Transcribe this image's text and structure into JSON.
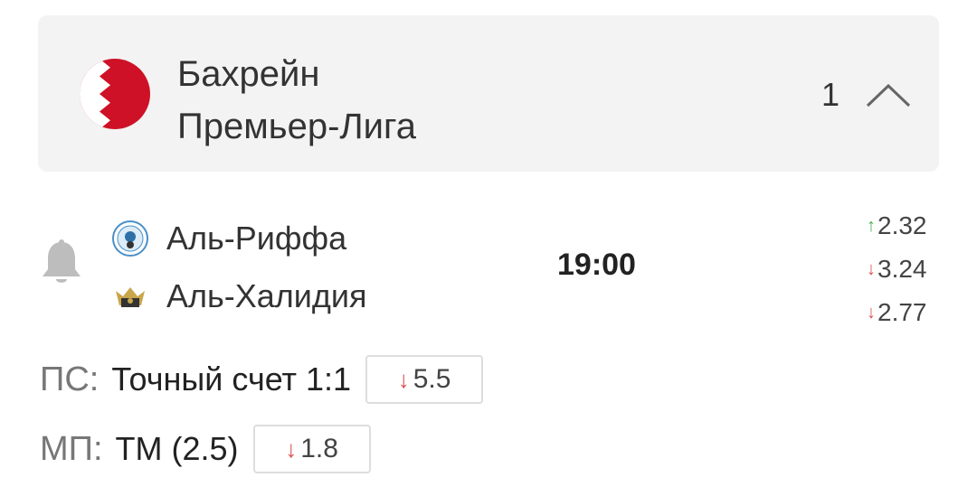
{
  "league": {
    "country": "Бахрейн",
    "name": "Премьер-Лига",
    "match_count": "1",
    "flag_colors": {
      "red": "#ce1126",
      "white": "#ffffff"
    }
  },
  "match": {
    "home_team": "Аль-Риффа",
    "away_team": "Аль-Халидия",
    "time": "19:00",
    "odds": [
      {
        "value": "2.32",
        "trend": "up",
        "arrow": "↑"
      },
      {
        "value": "3.24",
        "trend": "down",
        "arrow": "↓"
      },
      {
        "value": "2.77",
        "trend": "down",
        "arrow": "↓"
      }
    ]
  },
  "picks": [
    {
      "prefix": "ПС:",
      "text": "Точный счет 1:1",
      "arrow": "↓",
      "odd": "5.5"
    },
    {
      "prefix": "МП:",
      "text": "ТМ (2.5)",
      "arrow": "↓",
      "odd": "1.8"
    }
  ],
  "icons": {
    "notify": "bell-icon",
    "collapse": "chevron-up-icon",
    "flag": "bahrain-flag-icon"
  }
}
